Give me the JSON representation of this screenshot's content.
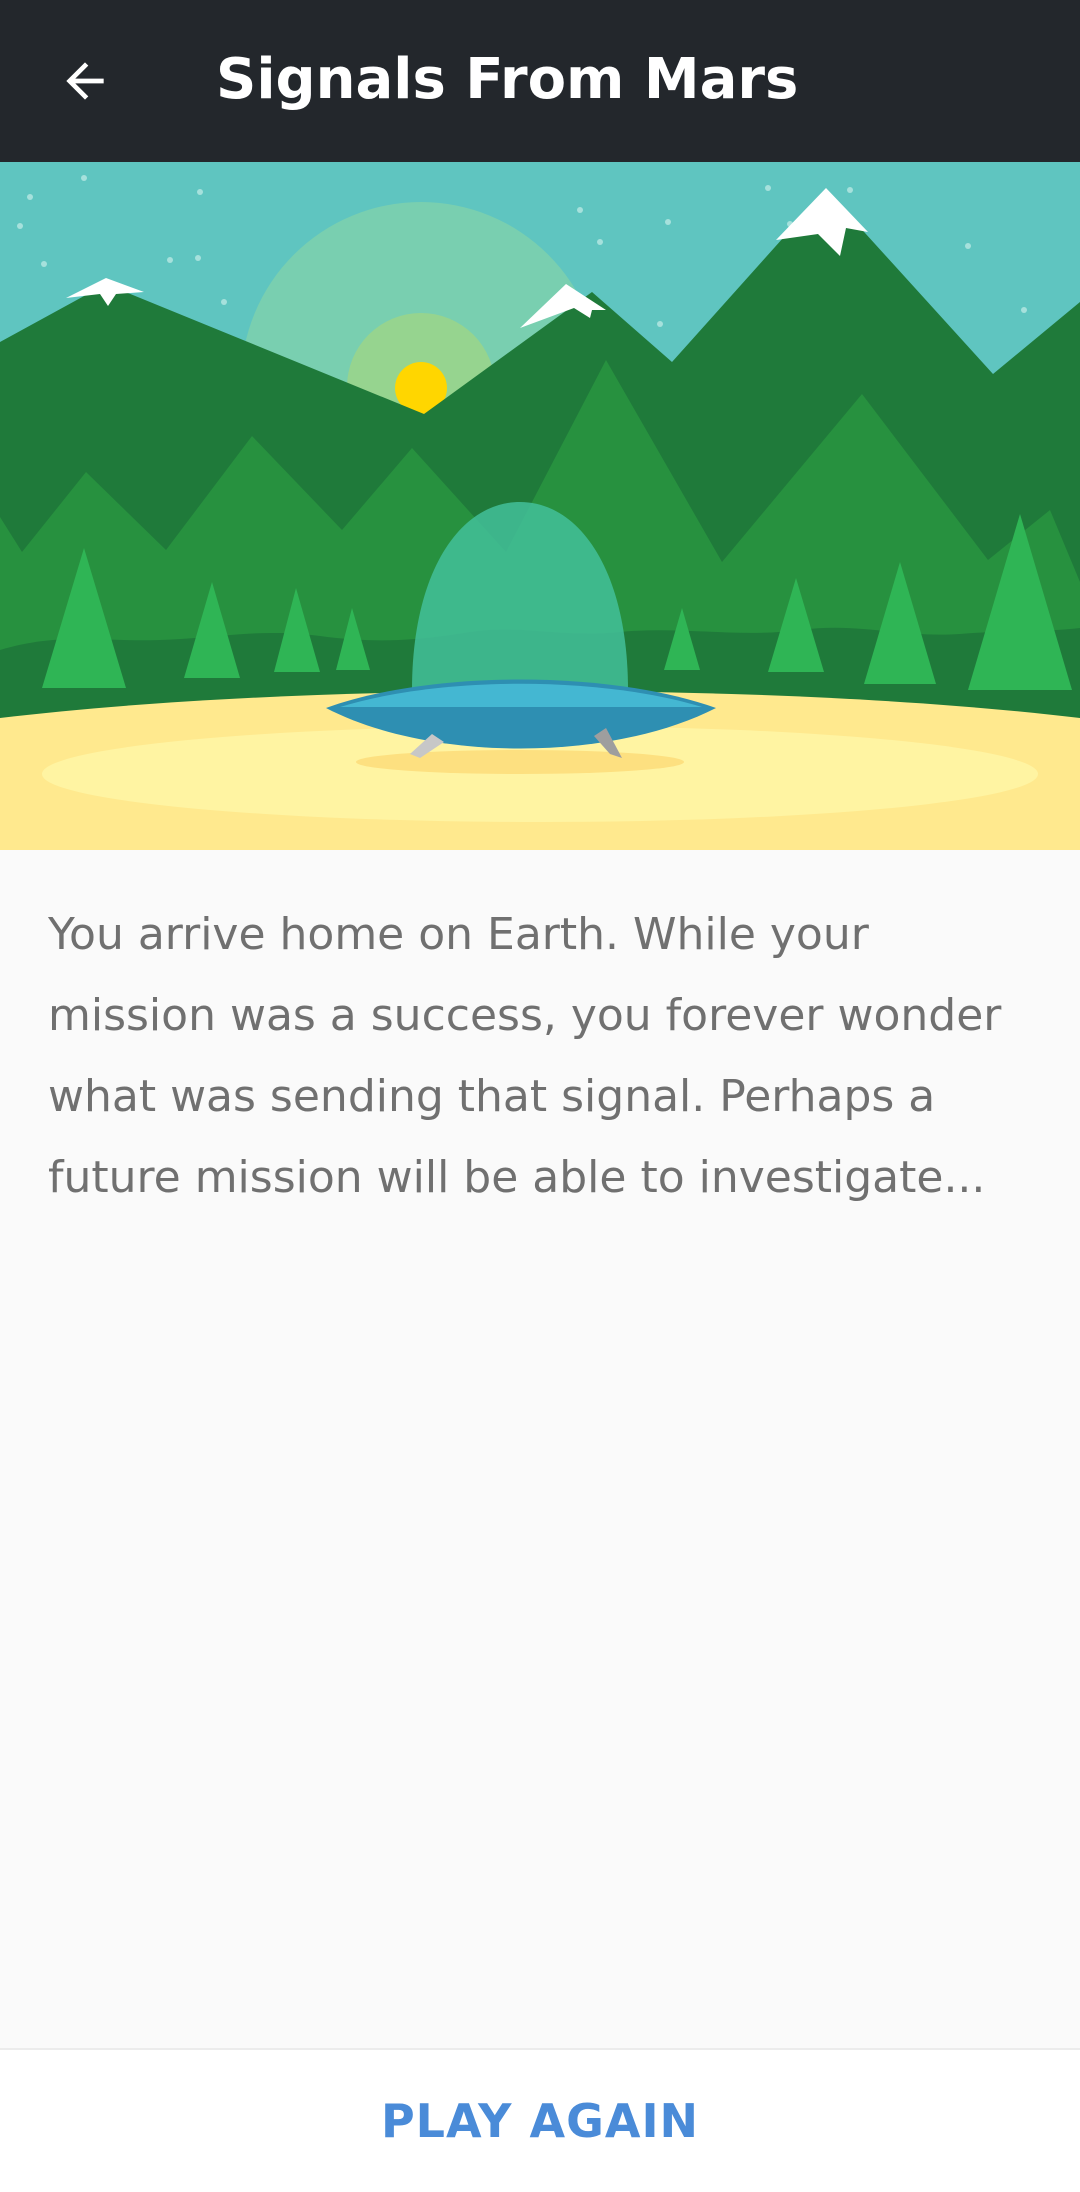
{
  "app_bar": {
    "title": "Signals From Mars",
    "back_icon": "arrow-left-icon"
  },
  "hero": {
    "description_icon": "ufo-landing-illustration",
    "colors": {
      "sky": "#5fc5c0",
      "mountain_dark": "#1f7a3a",
      "mountain_mid": "#27913f",
      "tree": "#2fb555",
      "ground": "#ffe98e",
      "sun": "#ffd600",
      "ship": "#2e8fb2",
      "dome": "#43bf9a"
    }
  },
  "story": {
    "text": "You arrive home on Earth. While your mission was a success, you forever wonder what was sending that signal. Perhaps a future mission will be able to investigate..."
  },
  "footer": {
    "play_again_label": "PLAY AGAIN",
    "accent": "#4a8bd8"
  }
}
